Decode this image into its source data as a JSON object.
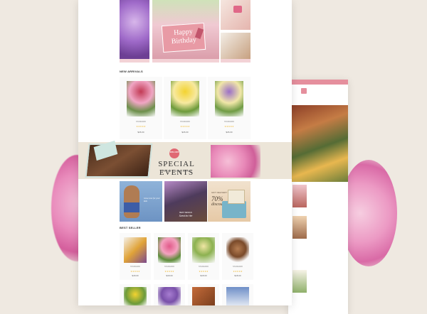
{
  "hero": {
    "card_text": "Happy Birthday"
  },
  "sections": {
    "new_arrivals": "NEW ARRIVALS",
    "best_seller": "BEST SELLER"
  },
  "new_arrivals": [
    {
      "name": "STANDARD",
      "price": "$26.00",
      "stars": "★★★★★",
      "colors": [
        "#c23a55",
        "#f0a6c4",
        "#6c8f4a"
      ]
    },
    {
      "name": "STANDARD",
      "price": "$26.00",
      "stars": "★★★★★",
      "colors": [
        "#f3d330",
        "#f7e9a0",
        "#6c9a3a"
      ]
    },
    {
      "name": "STANDARD",
      "price": "$26.00",
      "stars": "★★★★★",
      "colors": [
        "#9b6fc8",
        "#f1e7a8",
        "#6f9b44"
      ]
    }
  ],
  "banner": {
    "badge": "20% OFF",
    "title": "SPECIAL EVENTS",
    "date": "FROM 01/26 30/10"
  },
  "promos": {
    "bunny_text": "Glow love for your kids",
    "flowers_label": "BEST DESIGN",
    "flowers_text": "Scent for Her",
    "discount_label": "GIFT DELIVERY",
    "discount_value": "70%",
    "discount_word": "discount"
  },
  "best_seller": [
    {
      "name": "STANDARD",
      "price": "$18.00",
      "stars": "★★★★★",
      "colors": [
        "#e0a338",
        "#7c4a8d",
        "#f4f0e8"
      ]
    },
    {
      "name": "STANDARD",
      "price": "$18.00",
      "stars": "★★★★★",
      "colors": [
        "#e15a8a",
        "#f3a2bf",
        "#5d8c3a"
      ]
    },
    {
      "name": "STANDARD",
      "price": "$18.00",
      "stars": "★★★★★",
      "colors": [
        "#f0e6a4",
        "#8cb150",
        "#f7f7f2"
      ]
    },
    {
      "name": "STANDARD",
      "price": "$18.00",
      "stars": "★★★★★",
      "colors": [
        "#7a4a2a",
        "#b57d52",
        "#e9d7c4"
      ]
    }
  ],
  "colors": {
    "accent": "#e58f9d",
    "background": "#efe9e1",
    "star": "#f0c14b"
  }
}
